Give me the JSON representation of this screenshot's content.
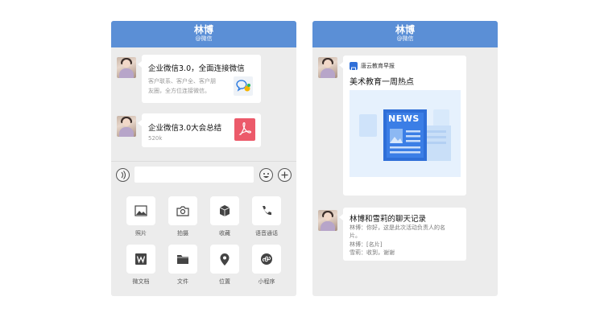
{
  "left_screen": {
    "header": {
      "title": "林博",
      "subtitle": "@微信"
    },
    "messages": [
      {
        "title": "企业微信3.0，全面连接微信",
        "desc_line1": "客户联系、客户全、客户朋",
        "desc_line2": "友圈，全方位连接微信。",
        "icon": "chat-bubbles-icon"
      },
      {
        "title": "企业微信3.0大会总结",
        "desc_line1": "520k",
        "icon": "pdf-icon"
      }
    ],
    "tools": [
      {
        "label": "照片",
        "icon": "image-icon"
      },
      {
        "label": "拍摄",
        "icon": "camera-icon"
      },
      {
        "label": "收藏",
        "icon": "cube-icon"
      },
      {
        "label": "语音通话",
        "icon": "phone-icon"
      },
      {
        "label": "微文档",
        "icon": "w-doc-icon"
      },
      {
        "label": "文件",
        "icon": "folder-icon"
      },
      {
        "label": "位置",
        "icon": "location-pin-icon"
      },
      {
        "label": "小程序",
        "icon": "mini-program-icon"
      }
    ]
  },
  "right_screen": {
    "header": {
      "title": "林博",
      "subtitle": "@微信"
    },
    "article": {
      "source": "唐云教育早报",
      "title": "美术教育一周热点",
      "badge": "NEWS"
    },
    "chat_record": {
      "title": "林博和雪莉的聊天记录",
      "line1": "林博：你好，这是此次活动负责人的名",
      "line2": "片。",
      "line3": "林博：[名片]",
      "line4": "雪莉：收到，谢谢"
    }
  },
  "colors": {
    "header_blue": "#5b8fd6",
    "pdf_red": "#ec5a6a",
    "news_blue": "#2f6fd8"
  }
}
